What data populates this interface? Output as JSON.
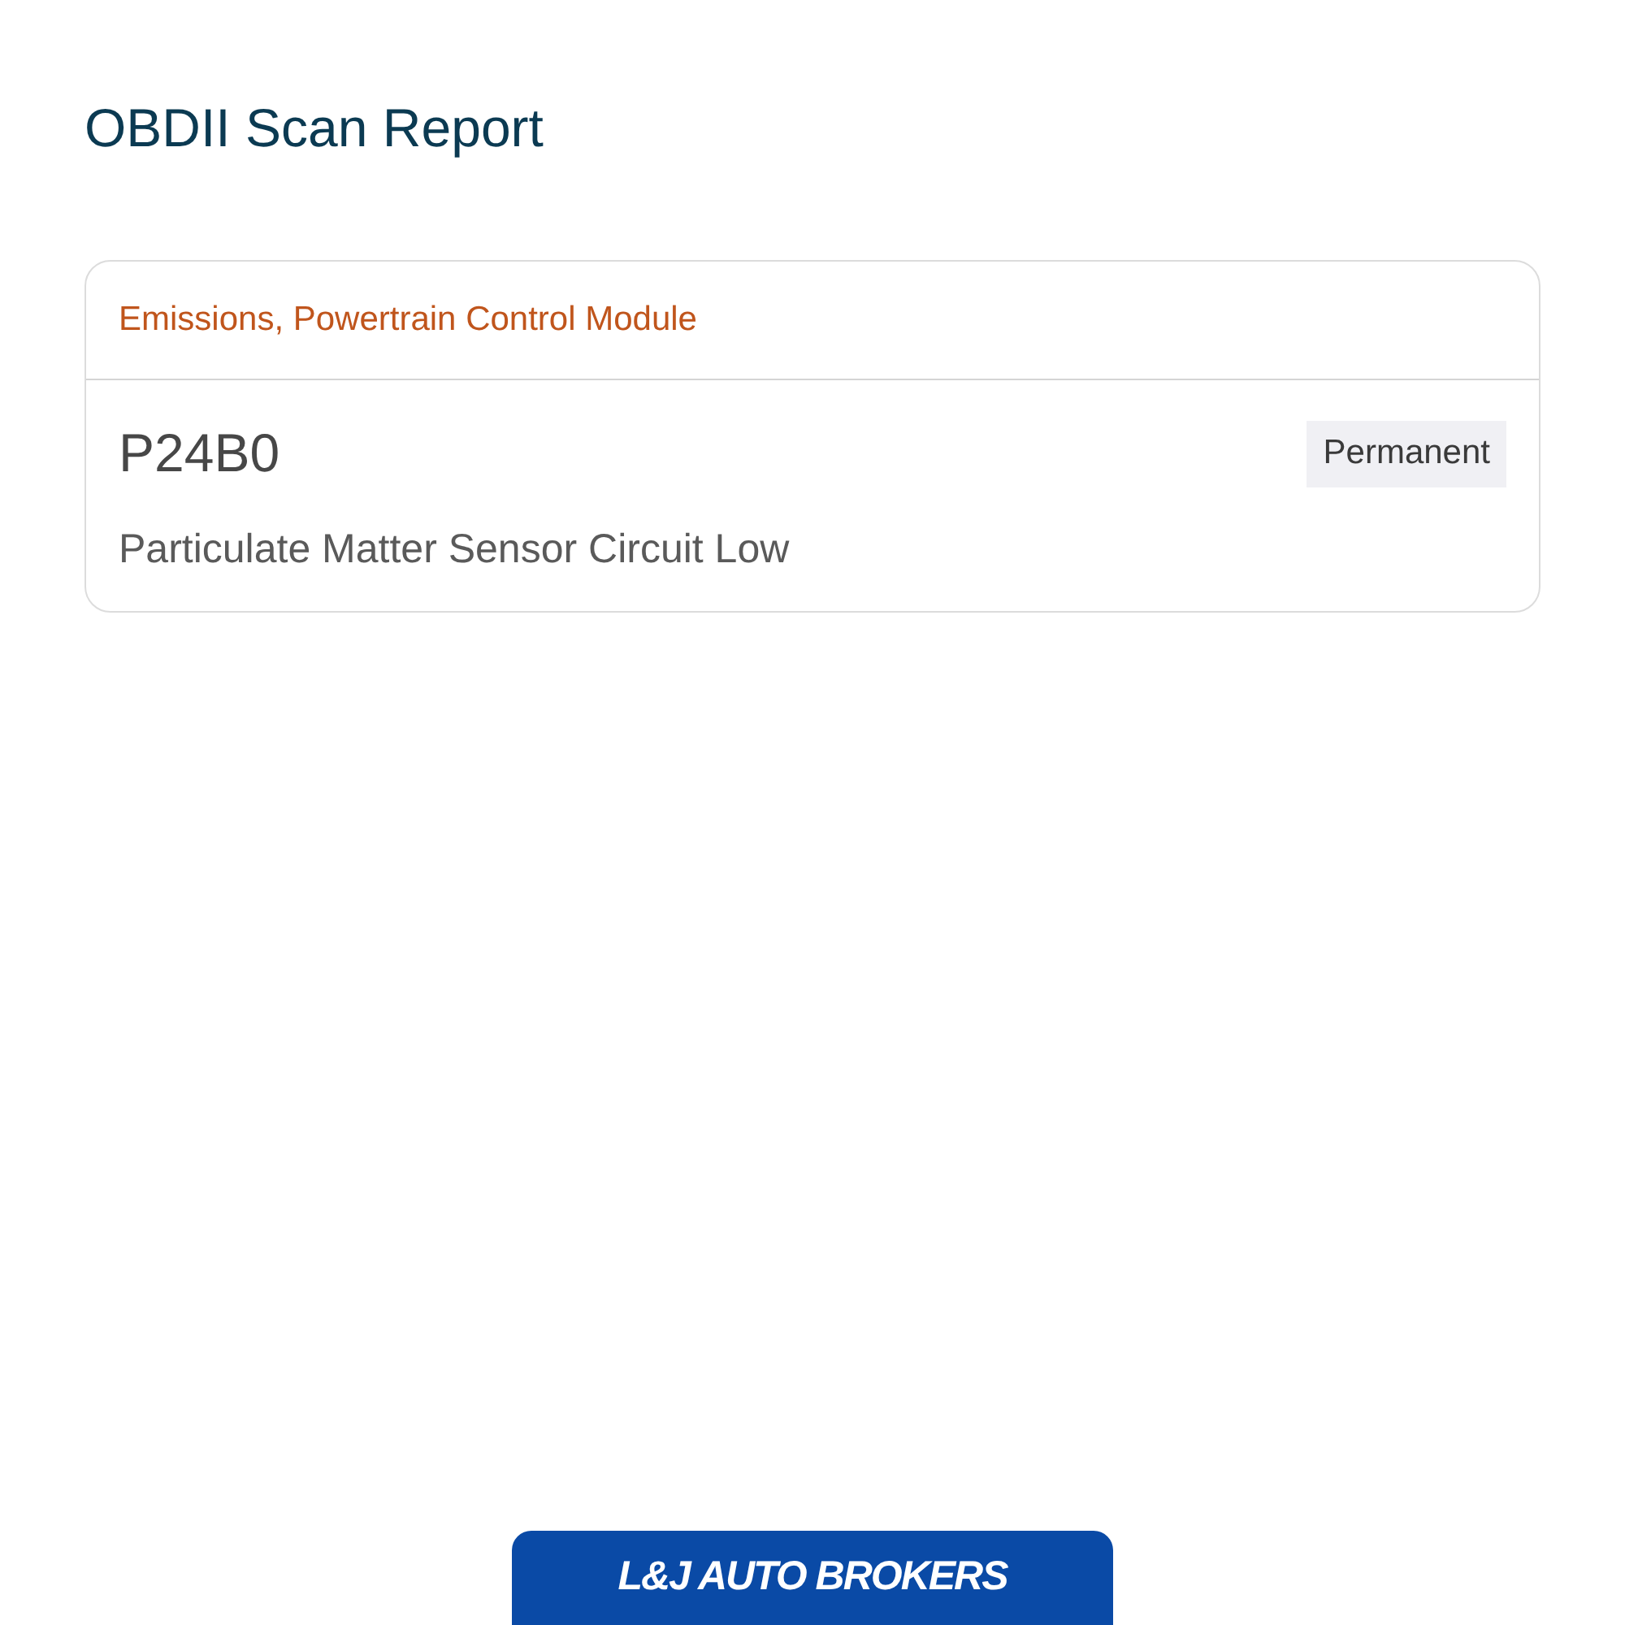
{
  "title": "OBDII Scan Report",
  "card": {
    "header": "Emissions, Powertrain Control Module",
    "codes": [
      {
        "code": "P24B0",
        "status": "Permanent",
        "description": "Particulate Matter Sensor Circuit Low"
      }
    ]
  },
  "footer": {
    "logo_text": "L&J AUTO BROKERS"
  }
}
